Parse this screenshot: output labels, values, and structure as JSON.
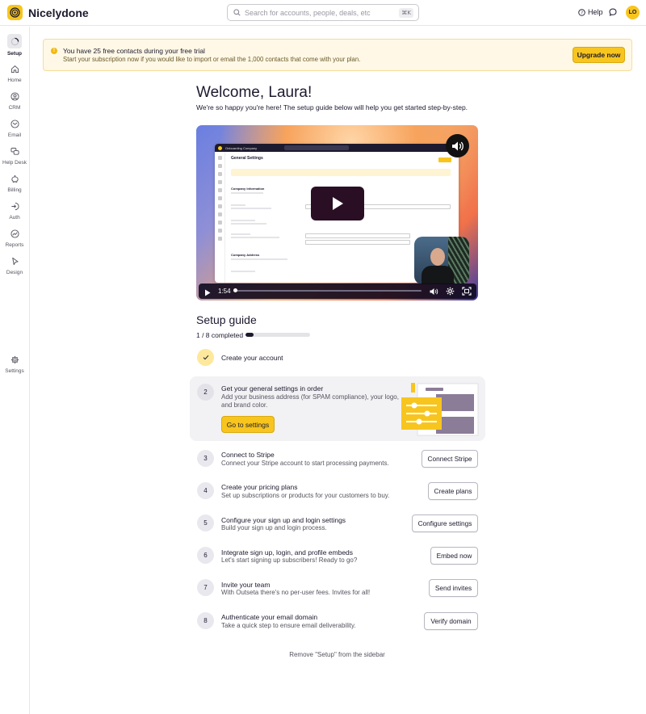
{
  "app": {
    "brand": "Nicelydone",
    "search_placeholder": "Search for accounts, people, deals, etc",
    "search_shortcut": "⌘K",
    "help_label": "Help",
    "avatar_initials": "LO"
  },
  "sidebar": {
    "items": [
      {
        "label": "Setup",
        "icon": "spinner-icon"
      },
      {
        "label": "Home",
        "icon": "home-icon"
      },
      {
        "label": "CRM",
        "icon": "person-circle-icon"
      },
      {
        "label": "Email",
        "icon": "envelope-icon"
      },
      {
        "label": "Help Desk",
        "icon": "chat-bubbles-icon"
      },
      {
        "label": "Billing",
        "icon": "piggy-bank-icon"
      },
      {
        "label": "Auth",
        "icon": "sign-in-icon"
      },
      {
        "label": "Reports",
        "icon": "chart-circle-icon"
      },
      {
        "label": "Design",
        "icon": "cursor-icon"
      }
    ],
    "settings_label": "Settings"
  },
  "banner": {
    "title": "You have 25 free contacts during your free trial",
    "subtitle": "Start your subscription now if you would like to import or email the 1,000 contacts that come with your plan.",
    "button": "Upgrade now"
  },
  "welcome": {
    "title": "Welcome, Laura!",
    "subtitle": "We're so happy you're here! The setup guide below will help you get started step-by-step."
  },
  "video": {
    "time": "1:54",
    "mock_app_name": "Onboarding Company",
    "mock_page_title": "General Settings",
    "mock_section_info": "Company Information",
    "mock_section_address": "Company Address"
  },
  "setup_guide": {
    "title": "Setup guide",
    "progress_text": "1 / 8 completed",
    "progress_fraction": 0.125,
    "steps": [
      {
        "num": "1",
        "title": "Create your account",
        "done": true
      },
      {
        "num": "2",
        "title": "Get your general settings in order",
        "desc_line1": "Add your business address (for SPAM compliance), your logo,",
        "desc_line2": "and brand color.",
        "button": "Go to settings"
      },
      {
        "num": "3",
        "title": "Connect to Stripe",
        "desc": "Connect your Stripe account to start processing payments.",
        "button": "Connect Stripe"
      },
      {
        "num": "4",
        "title": "Create your pricing plans",
        "desc": "Set up subscriptions or products for your customers to buy.",
        "button": "Create plans"
      },
      {
        "num": "5",
        "title": "Configure your sign up and login settings",
        "desc": "Build your sign up and login process.",
        "button": "Configure settings"
      },
      {
        "num": "6",
        "title": "Integrate sign up, login, and profile embeds",
        "desc": "Let's start signing up subscribers! Ready to go?",
        "button": "Embed now"
      },
      {
        "num": "7",
        "title": "Invite your team",
        "desc": "With Outseta there's no per-user fees. Invites for all!",
        "button": "Send invites"
      },
      {
        "num": "8",
        "title": "Authenticate your email domain",
        "desc": "Take a quick step to ensure email deliverability.",
        "button": "Verify domain"
      }
    ],
    "remove_link": "Remove \"Setup\" from the sidebar"
  },
  "colors": {
    "accent": "#f7c51e",
    "text": "#1d1a2f",
    "banner_bg": "#fff8e6"
  }
}
